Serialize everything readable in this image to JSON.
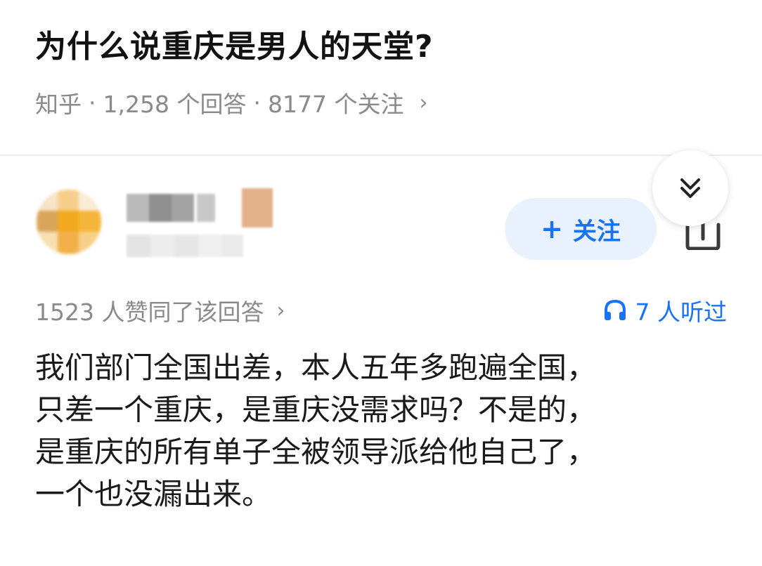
{
  "question": {
    "title": "为什么说重庆是男人的天堂?",
    "source": "知乎",
    "answer_count": "1,258 个回答",
    "follower_count": "8177 个关注",
    "separator": "·",
    "chevron": "›"
  },
  "answer": {
    "author_avatar_icon": "pixelated-avatar",
    "follow_label": "关注",
    "follow_plus": "+",
    "collapse_icon": "double-chevron-down-icon",
    "share_icon": "share-icon",
    "vote_text": "1523 人赞同了该回答",
    "vote_chevron": "›",
    "listen_icon": "headphones-icon",
    "listen_text": "7 人听过",
    "body_lines": [
      "我们部门全国出差，本人五年多跑遍全国，",
      "只差一个重庆，是重庆没需求吗？不是的，",
      "是重庆的所有单子全被领导派给他自己了，",
      "一个也没漏出来。"
    ]
  },
  "colors": {
    "accent": "#1772f6",
    "follow_bg": "#e9f1fd",
    "meta_text": "#8a8a8a",
    "title_text": "#121212"
  }
}
